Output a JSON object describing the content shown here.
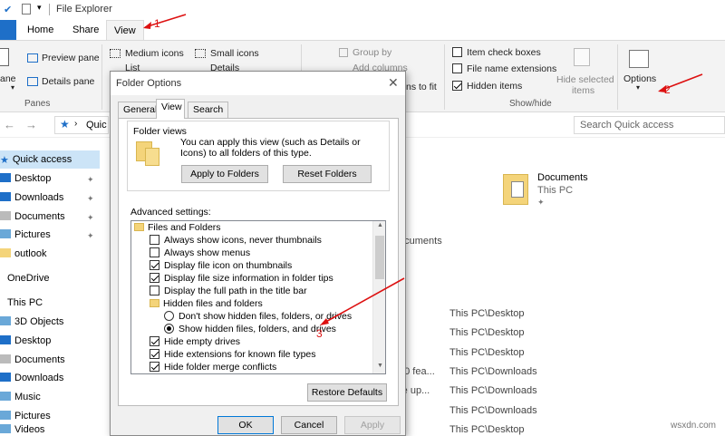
{
  "window": {
    "title": "File Explorer"
  },
  "ribbon_tabs": [
    {
      "label": "Home"
    },
    {
      "label": "Share"
    },
    {
      "label": "View"
    }
  ],
  "ribbon": {
    "panes": {
      "preview_pane": "Preview pane",
      "details_pane": "Details pane",
      "nav_pane": "ane",
      "group": "Panes"
    },
    "layout": {
      "medium_icons": "Medium icons",
      "small_icons": "Small icons",
      "list": "List",
      "details": "Details"
    },
    "current_view": {
      "group_by": "Group by",
      "add_columns": "Add columns",
      "size_to_fit": "ns to fit"
    },
    "show_hide": {
      "item_check_boxes": "Item check boxes",
      "file_name_extensions": "File name extensions",
      "hidden_items": "Hidden items",
      "hide_selected": "Hide selected",
      "items": "items",
      "group": "Show/hide"
    },
    "options": {
      "label": "Options"
    }
  },
  "address": {
    "partial": "Quic",
    "search_placeholder": "Search Quick access"
  },
  "nav": {
    "quick_access": "Quick access",
    "items": [
      "Desktop",
      "Downloads",
      "Documents",
      "Pictures",
      "outlook",
      "OneDrive",
      "This PC",
      "3D Objects",
      "Desktop",
      "Documents",
      "Downloads",
      "Music",
      "Pictures",
      "Videos"
    ]
  },
  "content": {
    "doc_name": "Documents",
    "doc_location": "This PC",
    "partial_1": "ocuments",
    "rows": [
      {
        "name": "",
        "loc": "This PC\\Desktop"
      },
      {
        "name": "",
        "loc": "This PC\\Desktop"
      },
      {
        "name": "",
        "loc": "This PC\\Desktop"
      },
      {
        "name": "10 fea...",
        "loc": "This PC\\Downloads"
      },
      {
        "name": "re up...",
        "loc": "This PC\\Downloads"
      },
      {
        "name": "",
        "loc": "This PC\\Downloads"
      },
      {
        "name": "",
        "loc": "This PC\\Desktop"
      }
    ]
  },
  "dialog": {
    "title": "Folder Options",
    "tabs": [
      "General",
      "View",
      "Search"
    ],
    "folder_views_title": "Folder views",
    "folder_views_desc": "You can apply this view (such as Details or Icons) to all folders of this type.",
    "apply_btn": "Apply to Folders",
    "reset_btn": "Reset Folders",
    "advanced_label": "Advanced settings:",
    "tree": {
      "files_and_folders": "Files and Folders",
      "items": [
        {
          "label": "Always show icons, never thumbnails",
          "checked": false
        },
        {
          "label": "Always show menus",
          "checked": false
        },
        {
          "label": "Display file icon on thumbnails",
          "checked": true
        },
        {
          "label": "Display file size information in folder tips",
          "checked": true
        },
        {
          "label": "Display the full path in the title bar",
          "checked": false
        }
      ],
      "hidden_group": "Hidden files and folders",
      "radio_1": "Don't show hidden files, folders, or drives",
      "radio_2": "Show hidden files, folders, and drives",
      "after": [
        {
          "label": "Hide empty drives",
          "checked": true
        },
        {
          "label": "Hide extensions for known file types",
          "checked": true
        },
        {
          "label": "Hide folder merge conflicts",
          "checked": true
        }
      ]
    },
    "restore_btn": "Restore Defaults",
    "ok_btn": "OK",
    "cancel_btn": "Cancel",
    "apply_btn2": "Apply"
  },
  "annotations": {
    "a1": "1",
    "a2": "2",
    "a3": "3"
  },
  "watermark": "wsxdn.com",
  "colors": {
    "accent": "#1e6fc8",
    "annotation": "#dd1111",
    "folder": "#f4d47a"
  }
}
